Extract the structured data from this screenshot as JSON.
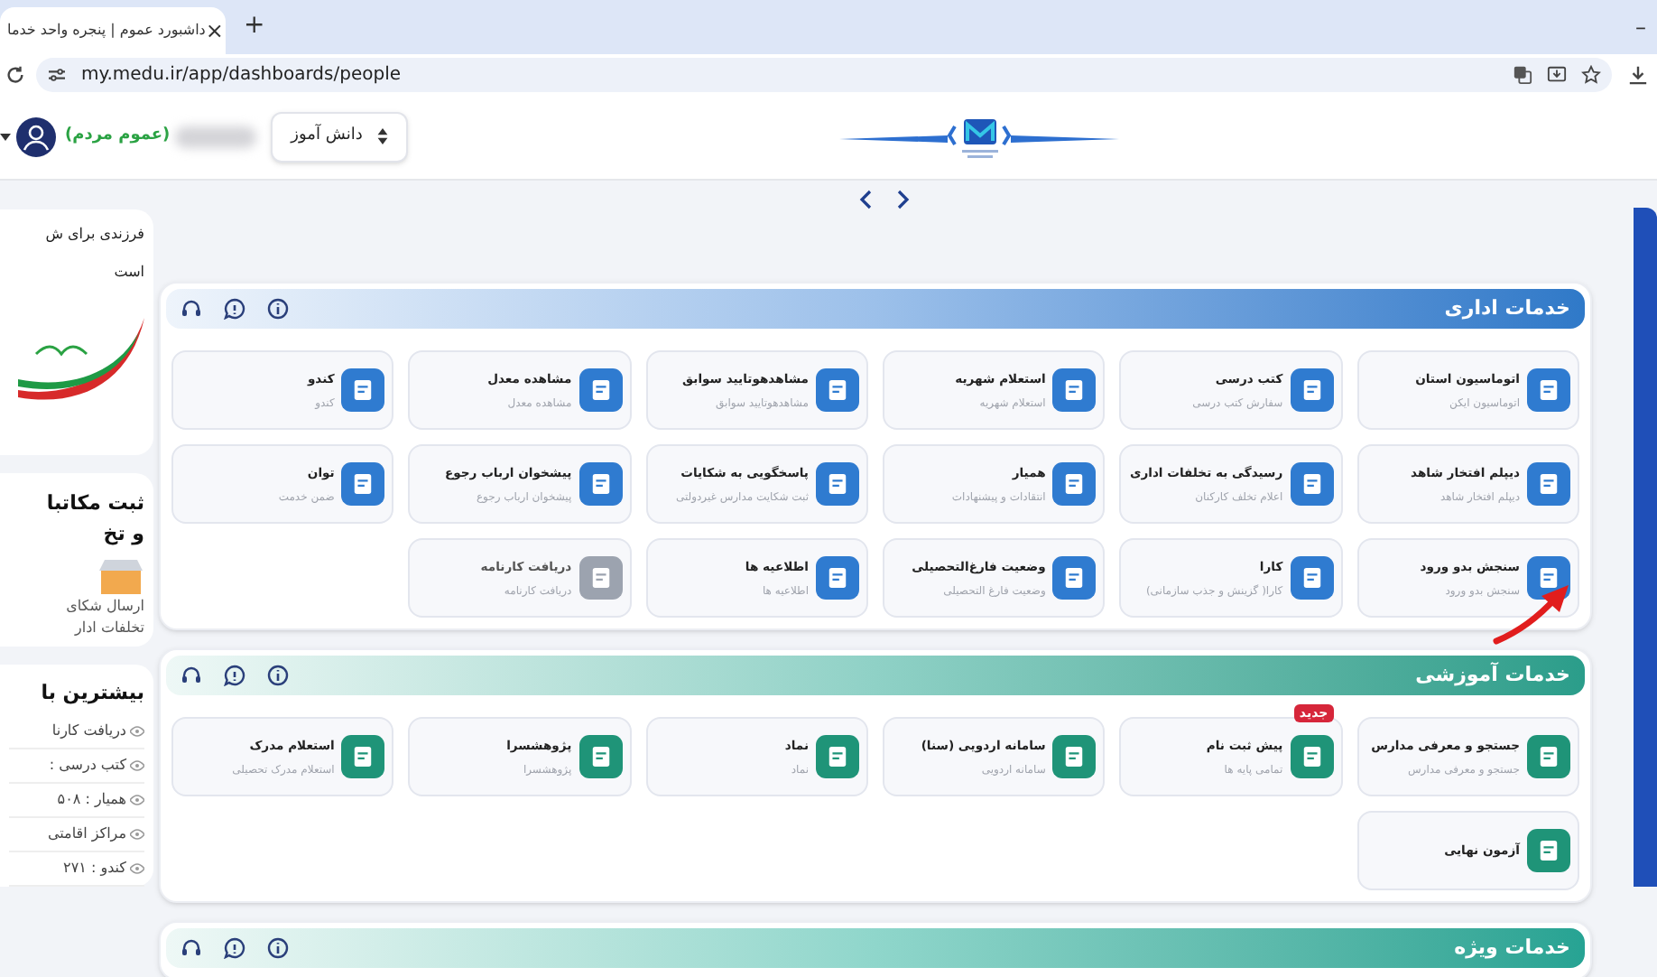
{
  "browser": {
    "tab_title": "داشبورد عموم | پنجره واحد خدما",
    "close": "×",
    "new_tab": "+",
    "minimize": "–",
    "url": "my.medu.ir/app/dashboards/people"
  },
  "header": {
    "user_role": "(عموم مردم)",
    "role_select": "دانش آموز"
  },
  "sidebar": {
    "promo": {
      "lines": [
        "فرزندی برای ش",
        "است"
      ]
    },
    "complaint": {
      "title_lines": [
        "ثبت مکاتبا",
        "و تخ"
      ],
      "text_lines": [
        "ارسال شکای",
        "تخلفات ادار"
      ]
    },
    "stats": {
      "title": "بیشترین با",
      "items": [
        "دریافت کارنا",
        "کتب درسی :",
        "همیار : ۵۰۸",
        "مراکز اقامتی",
        "کندو : ۲۷۱"
      ]
    }
  },
  "sections": [
    {
      "kind": "admin",
      "title": "خدمات اداری",
      "cards": [
        {
          "title": "اتوماسیون استان",
          "subtitle": "اتوماسیون ایکن",
          "disabled": false
        },
        {
          "title": "کتب درسی",
          "subtitle": "سفارش کتب درسی",
          "disabled": false
        },
        {
          "title": "استعلام شهریه",
          "subtitle": "استعلام شهریه",
          "disabled": false
        },
        {
          "title": "مشاهدهوتایید سوابق",
          "subtitle": "مشاهدهوتایید سوابق",
          "disabled": false
        },
        {
          "title": "مشاهده معدل",
          "subtitle": "مشاهده معدل",
          "disabled": false
        },
        {
          "title": "کندو",
          "subtitle": "کندو",
          "disabled": false
        },
        {
          "title": "دیپلم افتخار شاهد",
          "subtitle": "دیپلم افتخار شاهد",
          "disabled": false
        },
        {
          "title": "رسیدگی به تخلفات اداری",
          "subtitle": "اعلام تخلف کارکنان",
          "disabled": false
        },
        {
          "title": "همیار",
          "subtitle": "انتقادات و پیشنهادات",
          "disabled": false
        },
        {
          "title": "پاسخگویی به شکایات",
          "subtitle": "ثبت شکایت مدارس غیردولتی",
          "disabled": false
        },
        {
          "title": "پیشخوان ارباب رجوع",
          "subtitle": "پیشخوان ارباب رجوع",
          "disabled": false
        },
        {
          "title": "توان",
          "subtitle": "ضمن خدمت",
          "disabled": false
        },
        {
          "title": "سنجش بدو ورود",
          "subtitle": "سنجش بدو ورود",
          "disabled": false
        },
        {
          "title": "کارا",
          "subtitle": "کارا( گزینش و جذب سازمانی)",
          "disabled": false
        },
        {
          "title": "وضعیت فارغ‌التحصیلی",
          "subtitle": "وضعیت فارغ التحصیلی",
          "disabled": false
        },
        {
          "title": "اطلاعیه ها",
          "subtitle": "اطلاعیه ها",
          "disabled": false
        },
        {
          "title": "دریافت کارنامه",
          "subtitle": "دریافت کارنامه",
          "disabled": true
        }
      ]
    },
    {
      "kind": "education",
      "title": "خدمات آموزشی",
      "cards": [
        {
          "title": "جستجو و معرفی مدارس",
          "subtitle": "جستجو و معرفی مدارس",
          "disabled": false
        },
        {
          "title": "پیش ثبت نام",
          "subtitle": "تمامی پایه ها",
          "badge": "جدید",
          "disabled": false
        },
        {
          "title": "سامانه اردویی (سنا)",
          "subtitle": "سامانه اردویی",
          "disabled": false
        },
        {
          "title": "نماد",
          "subtitle": "نماد",
          "disabled": false
        },
        {
          "title": "پژوهشسرا",
          "subtitle": "پژوهشسرا",
          "disabled": false
        },
        {
          "title": "استعلام مدرک",
          "subtitle": "استعلام مدرک تحصیلی",
          "disabled": false
        },
        {
          "title": "آزمون نهایی",
          "disabled": false
        }
      ]
    },
    {
      "kind": "special",
      "title": "خدمات ویژه"
    }
  ]
}
